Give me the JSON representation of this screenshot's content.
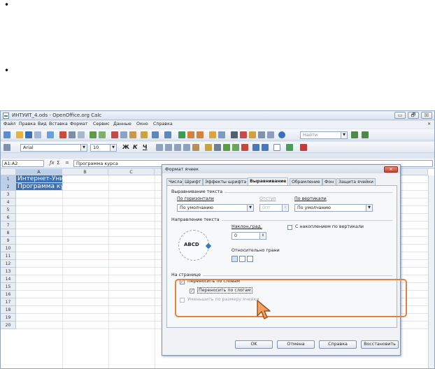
{
  "bullets": [
    "•",
    "•"
  ],
  "window": {
    "title": "ИНТУИТ_4.ods - OpenOffice.org Calc",
    "minimize": "▭",
    "restore": "🗗",
    "close": "☒"
  },
  "menu": [
    "Файл",
    "Правка",
    "Вид",
    "Вставка",
    "Формат",
    "Сервис",
    "Данные",
    "Окно",
    "Справка"
  ],
  "toolbar": {
    "search_placeholder": "Найти",
    "font_name": "Arial",
    "font_size": "10",
    "bold": "Ж",
    "italic": "К",
    "underline": "Ч"
  },
  "formula_bar": {
    "cell_ref": "A1:A2",
    "fx": "ƒx",
    "sum": "Σ",
    "equals": "=",
    "content": "Программа курса"
  },
  "sheet": {
    "columns": [
      "A",
      "B",
      "C"
    ],
    "rows": [
      "1",
      "2",
      "3",
      "4",
      "5",
      "6",
      "7",
      "8",
      "9",
      "10",
      "11",
      "12",
      "13",
      "14",
      "15",
      "16",
      "17",
      "18",
      "19",
      "20"
    ],
    "cells": {
      "a1": "Интернет-Университет информационных те",
      "a2": "Программа курса"
    }
  },
  "dialog": {
    "title": "Формат ячеек",
    "close": "✕",
    "tabs": [
      "Числа",
      "Шрифт",
      "Эффекты шрифта",
      "Выравнивание",
      "Обрамление",
      "Фон",
      "Защита ячейки"
    ],
    "active_tab": "Выравнивание",
    "alignment": {
      "group": "Выравнивание текста",
      "horizontal_label": "По горизонтали",
      "horizontal_value": "По умолчанию",
      "indent_label": "Отступ",
      "indent_value": "0пт",
      "vertical_label": "По вертикали",
      "vertical_value": "По умолчанию"
    },
    "orientation": {
      "group": "Направление текста",
      "dial_text": "ABCD",
      "angle_label": "Наклон,град.",
      "angle_value": "0",
      "stacked_label": "С накоплением по вертикали",
      "reference_label": "Относительно грани"
    },
    "properties": {
      "group": "На странице",
      "wrap_words": "Переносить по словам",
      "hyphenation": "Переносить по слогам",
      "shrink": "Уменьшить по размеру ячейки"
    },
    "buttons": {
      "ok": "OK",
      "cancel": "Отмена",
      "help": "Справка",
      "reset": "Восстановить"
    }
  },
  "colors": {
    "highlight": "#e8813b",
    "selection": "#3b6fb6",
    "accent": "#3a78c9"
  }
}
